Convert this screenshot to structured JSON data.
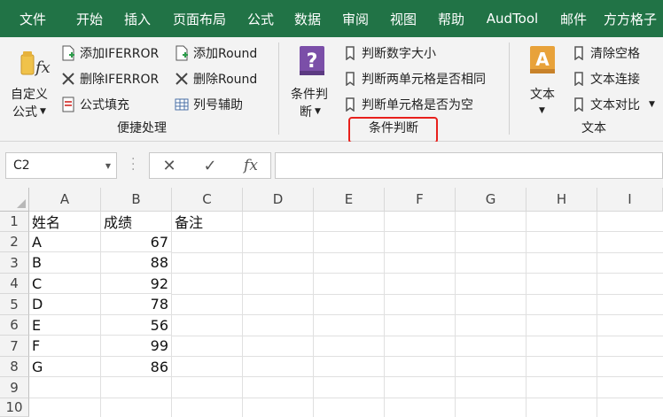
{
  "tabs": [
    "文件",
    "开始",
    "插入",
    "页面布局",
    "公式",
    "数据",
    "审阅",
    "视图",
    "帮助",
    "AudTool",
    "邮件",
    "方方格子"
  ],
  "ribbon": {
    "custom_formula_line1": "自定义",
    "custom_formula_line2": "公式",
    "add_iferror": "添加IFERROR",
    "del_iferror": "删除IFERROR",
    "formula_fill": "公式填充",
    "add_round": "添加Round",
    "del_round": "删除Round",
    "column_helper": "列号辅助",
    "group_convenience": "便捷处理",
    "cond_judge_line1": "条件判",
    "cond_judge_line2": "断",
    "judge_number_size": "判断数字大小",
    "judge_two_cells_same": "判断两单元格是否相同",
    "judge_cell_empty": "判断单元格是否为空",
    "group_condition": "条件判断",
    "text_btn": "文本",
    "clear_spaces": "清除空格",
    "text_join": "文本连接",
    "text_compare": "文本对比",
    "group_text": "文本"
  },
  "formula_bar": {
    "name_box": "C2",
    "cancel": "✕",
    "enter": "✓",
    "fx": "fx",
    "formula": ""
  },
  "grid": {
    "columns": [
      "A",
      "B",
      "C",
      "D",
      "E",
      "F",
      "G",
      "H",
      "I"
    ],
    "rows": [
      "1",
      "2",
      "3",
      "4",
      "5",
      "6",
      "7",
      "8",
      "9",
      "10"
    ],
    "header_row": [
      "姓名",
      "成绩",
      "备注"
    ],
    "data": [
      {
        "name": "A",
        "score": "67"
      },
      {
        "name": "B",
        "score": "88"
      },
      {
        "name": "C",
        "score": "92"
      },
      {
        "name": "D",
        "score": "78"
      },
      {
        "name": "E",
        "score": "56"
      },
      {
        "name": "F",
        "score": "99"
      },
      {
        "name": "G",
        "score": "86"
      }
    ]
  },
  "colors": {
    "tab_bar": "#217346",
    "highlight_border": "#e8201c",
    "purple_icon": "#7b4fa8",
    "orange_icon": "#e8a23a"
  }
}
